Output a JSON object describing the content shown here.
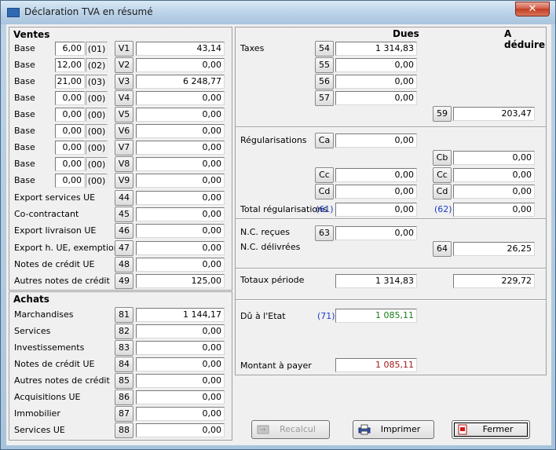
{
  "window": {
    "title": "Déclaration TVA en résumé",
    "close_label": "✕",
    "app_icon_text": ""
  },
  "ventes": {
    "title": "Ventes",
    "base_label": "Base",
    "bases": [
      {
        "rate": "6,00",
        "code": "(01)",
        "btn": "V1",
        "value": "43,14"
      },
      {
        "rate": "12,00",
        "code": "(02)",
        "btn": "V2",
        "value": "0,00"
      },
      {
        "rate": "21,00",
        "code": "(03)",
        "btn": "V3",
        "value": "6 248,77"
      },
      {
        "rate": "0,00",
        "code": "(00)",
        "btn": "V4",
        "value": "0,00"
      },
      {
        "rate": "0,00",
        "code": "(00)",
        "btn": "V5",
        "value": "0,00"
      },
      {
        "rate": "0,00",
        "code": "(00)",
        "btn": "V6",
        "value": "0,00"
      },
      {
        "rate": "0,00",
        "code": "(00)",
        "btn": "V7",
        "value": "0,00"
      },
      {
        "rate": "0,00",
        "code": "(00)",
        "btn": "V8",
        "value": "0,00"
      },
      {
        "rate": "0,00",
        "code": "(00)",
        "btn": "V9",
        "value": "0,00"
      }
    ],
    "others": [
      {
        "label": "Export services UE",
        "btn": "44",
        "value": "0,00"
      },
      {
        "label": "Co-contractant",
        "btn": "45",
        "value": "0,00"
      },
      {
        "label": "Export livraison UE",
        "btn": "46",
        "value": "0,00"
      },
      {
        "label": "Export h. UE, exemptions",
        "btn": "47",
        "value": "0,00"
      },
      {
        "label": "Notes de crédit UE",
        "btn": "48",
        "value": "0,00"
      },
      {
        "label": "Autres notes de crédit",
        "btn": "49",
        "value": "125,00"
      }
    ]
  },
  "achats": {
    "title": "Achats",
    "rows": [
      {
        "label": "Marchandises",
        "btn": "81",
        "value": "1 144,17"
      },
      {
        "label": "Services",
        "btn": "82",
        "value": "0,00"
      },
      {
        "label": "Investissements",
        "btn": "83",
        "value": "0,00"
      },
      {
        "label": "Notes de crédit UE",
        "btn": "84",
        "value": "0,00"
      },
      {
        "label": "Autres notes de crédit",
        "btn": "85",
        "value": "0,00"
      },
      {
        "label": "Acquisitions UE",
        "btn": "86",
        "value": "0,00"
      },
      {
        "label": "Immobilier",
        "btn": "87",
        "value": "0,00"
      },
      {
        "label": "Services UE",
        "btn": "88",
        "value": "0,00"
      }
    ]
  },
  "right": {
    "hdr_dues": "Dues",
    "hdr_deduire": "A déduire",
    "taxes_label": "Taxes",
    "taxes": [
      {
        "btn": "54",
        "value": "1 314,83"
      },
      {
        "btn": "55",
        "value": "0,00"
      },
      {
        "btn": "56",
        "value": "0,00"
      },
      {
        "btn": "57",
        "value": "0,00"
      }
    ],
    "deduct59": {
      "btn": "59",
      "value": "203,47"
    },
    "regul_label": "Régularisations",
    "ca": {
      "btn": "Ca",
      "value": "0,00"
    },
    "cb": {
      "btn": "Cb",
      "value": "0,00"
    },
    "cc_left": {
      "btn": "Cc",
      "value": "0,00"
    },
    "cc_right": {
      "btn": "Cc",
      "value": "0,00"
    },
    "cd_left": {
      "btn": "Cd",
      "value": "0,00"
    },
    "cd_right": {
      "btn": "Cd",
      "value": "0,00"
    },
    "total_regul_label": "Total régularisations",
    "total_regul_code_left": "(61)",
    "total_regul_left": "0,00",
    "total_regul_code_right": "(62)",
    "total_regul_right": "0,00",
    "nc_recues_label": "N.C. reçues",
    "nc_recues": {
      "btn": "63",
      "value": "0,00"
    },
    "nc_delivrees_label": "N.C. délivrées",
    "nc_delivrees": {
      "btn": "64",
      "value": "26,25"
    },
    "totaux_label": "Totaux période",
    "totaux_left": "1 314,83",
    "totaux_right": "229,72",
    "du_label": "Dû à l'Etat",
    "du_code": "(71)",
    "du_value": "1 085,11",
    "montant_label": "Montant à payer",
    "montant_value": "1 085,11"
  },
  "buttons": {
    "recalcul": "Recalcul",
    "imprimer": "Imprimer",
    "fermer": "Fermer"
  }
}
